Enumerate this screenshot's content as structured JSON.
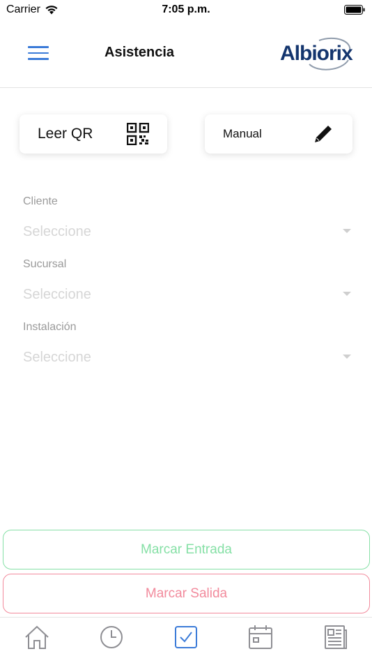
{
  "status_bar": {
    "carrier": "Carrier",
    "time": "7:05 p.m."
  },
  "header": {
    "title": "Asistencia",
    "logo_text": "Albiorix",
    "brand_color": "#14356e"
  },
  "mode_buttons": {
    "qr_label": "Leer QR",
    "manual_label": "Manual"
  },
  "form": {
    "fields": [
      {
        "label": "Cliente",
        "placeholder": "Seleccione"
      },
      {
        "label": "Sucursal",
        "placeholder": "Seleccione"
      },
      {
        "label": "Instalación",
        "placeholder": "Seleccione"
      }
    ]
  },
  "actions": {
    "check_in_label": "Marcar Entrada",
    "check_out_label": "Marcar Salida"
  },
  "colors": {
    "accent": "#3b7bd8",
    "check_in": "#86e0a6",
    "check_out": "#f28a9c",
    "tab_icon": "#8e8e93"
  },
  "tab_bar": {
    "tabs": [
      {
        "icon": "home-icon",
        "active": false
      },
      {
        "icon": "clock-icon",
        "active": false
      },
      {
        "icon": "checkbox-icon",
        "active": true
      },
      {
        "icon": "calendar-icon",
        "active": false
      },
      {
        "icon": "newspaper-icon",
        "active": false
      }
    ]
  }
}
